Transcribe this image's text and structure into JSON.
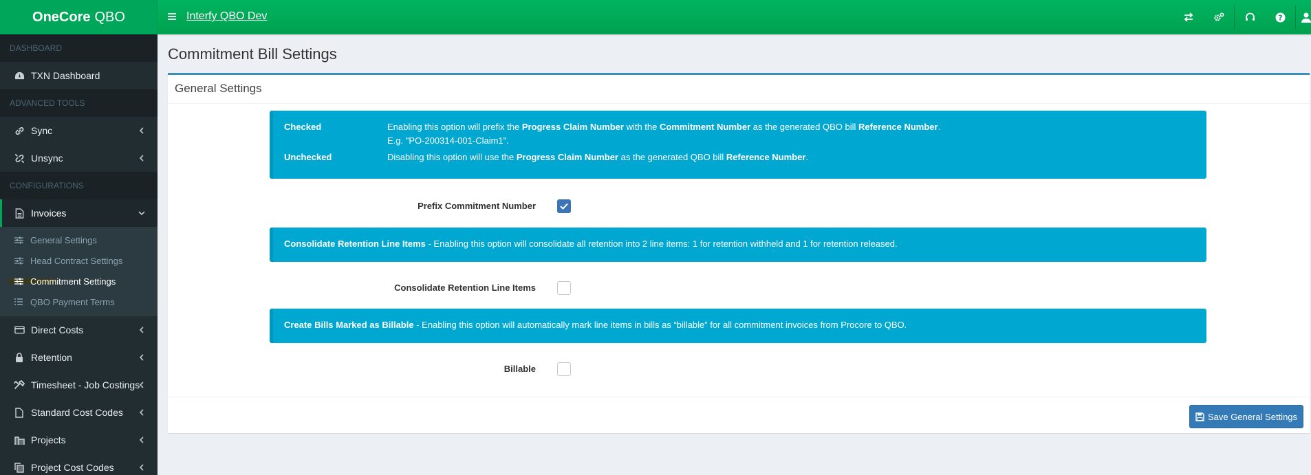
{
  "app": {
    "brand_bold": "OneCore",
    "brand_rest": "QBO",
    "company": "Interfy QBO Dev"
  },
  "sidebar": {
    "headers": {
      "dashboard": "DASHBOARD",
      "advanced": "ADVANCED TOOLS",
      "config": "CONFIGURATIONS"
    },
    "items": {
      "txn_dashboard": "TXN Dashboard",
      "sync": "Sync",
      "unsync": "Unsync",
      "invoices": "Invoices",
      "direct_costs": "Direct Costs",
      "retention": "Retention",
      "timesheet": "Timesheet - Job Costings",
      "standard_cost_codes": "Standard Cost Codes",
      "projects": "Projects",
      "project_cost_codes": "Project Cost Codes"
    },
    "invoice_sub": {
      "general": "General Settings",
      "head_contract": "Head Contract Settings",
      "commitment": "Commitment Settings",
      "payment_terms": "QBO Payment Terms"
    }
  },
  "page": {
    "title": "Commitment Bill Settings",
    "box_title": "General Settings"
  },
  "info1": {
    "checked_label": "Checked",
    "checked_t1": "Enabling this option will prefix the ",
    "checked_b1": "Progress Claim Number",
    "checked_t2": " with the ",
    "checked_b2": "Commitment Number",
    "checked_t3": " as the generated QBO bill ",
    "checked_b3": "Reference Number",
    "checked_t4": ".",
    "example": "E.g. \"PO-200314-001-Claim1\".",
    "unchecked_label": "Unchecked",
    "unchecked_t1": "Disabling this option will use the ",
    "unchecked_b1": "Progress Claim Number",
    "unchecked_t2": " as the generated QBO bill ",
    "unchecked_b2": "Reference Number",
    "unchecked_t3": "."
  },
  "info2": {
    "bold": "Consolidate Retention Line Items",
    "text": " - Enabling this option will consolidate all retention into 2 line items: 1 for retention withheld and 1 for retention released."
  },
  "info3": {
    "bold": "Create Bills Marked as Billable",
    "text": " - Enabling this option will automatically mark line items in bills as “billable” for all commitment invoices from Procore to QBO."
  },
  "fields": {
    "prefix": {
      "label": "Prefix Commitment Number",
      "checked": true
    },
    "consolidate": {
      "label": "Consolidate Retention Line Items",
      "checked": false
    },
    "billable": {
      "label": "Billable",
      "checked": false
    }
  },
  "footer": {
    "save_label": "Save General Settings"
  },
  "colors": {
    "brand_green": "#00a65a",
    "sidebar_bg": "#222d32",
    "info_bg": "#00a7d0",
    "primary": "#337ab7"
  }
}
